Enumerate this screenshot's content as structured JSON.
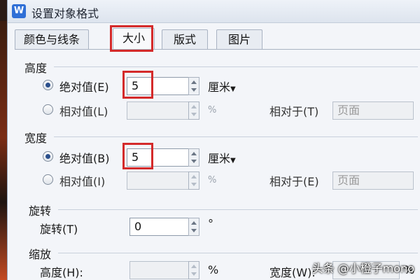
{
  "window": {
    "title": "设置对象格式",
    "app_icon_letter": "W",
    "app_icon": "wps-writer-icon"
  },
  "tabs": [
    {
      "label": "颜色与线条",
      "active": false
    },
    {
      "label": "大小",
      "active": true
    },
    {
      "label": "版式",
      "active": false
    },
    {
      "label": "图片",
      "active": false
    }
  ],
  "height_section": {
    "heading": "高度",
    "absolute": {
      "label": "绝对值(E)",
      "value": "5",
      "unit": "厘米",
      "selected": true
    },
    "relative": {
      "label": "相对值(L)",
      "value": "",
      "unit": "%",
      "selected": false
    },
    "relative_to": {
      "label": "相对于(T)",
      "value": "页面"
    }
  },
  "width_section": {
    "heading": "宽度",
    "absolute": {
      "label": "绝对值(B)",
      "value": "5",
      "unit": "厘米",
      "selected": true
    },
    "relative": {
      "label": "相对值(I)",
      "value": "",
      "unit": "%",
      "selected": false
    },
    "relative_to": {
      "label": "相对于(E)",
      "value": "页面"
    }
  },
  "rotate_section": {
    "heading": "旋转",
    "label": "旋转(T)",
    "value": "0",
    "unit": "°"
  },
  "scale_section": {
    "heading": "缩放",
    "height_label": "高度(H):",
    "height_unit": "%",
    "width_label": "宽度(W):",
    "width_unit": "%"
  },
  "watermark": "头条 @小橙子mono",
  "highlight_color": "#d42a2a"
}
